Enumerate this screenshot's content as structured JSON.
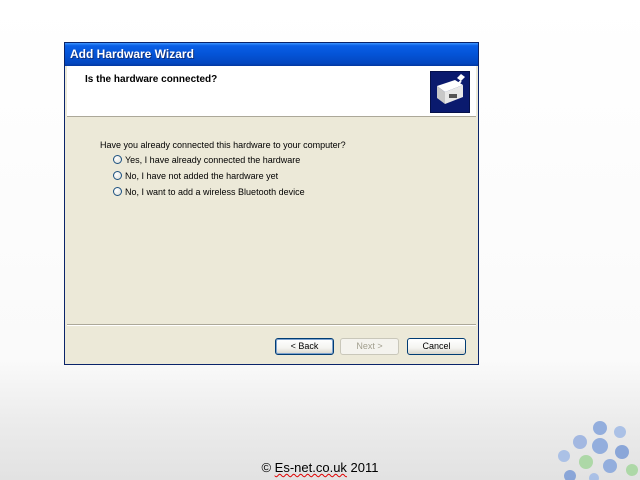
{
  "window": {
    "title": "Add Hardware Wizard",
    "header_title": "Is the hardware connected?"
  },
  "content": {
    "question": "Have you already connected this hardware to your computer?",
    "options": [
      {
        "label": "Yes, I have already connected the hardware",
        "selected": false
      },
      {
        "label": "No, I have not added the hardware yet",
        "selected": false
      },
      {
        "label": "No, I want to add a wireless Bluetooth device",
        "selected": false
      }
    ]
  },
  "buttons": {
    "back": "< Back",
    "next": "Next >",
    "cancel": "Cancel"
  },
  "footer": {
    "prefix": "© ",
    "site": "Es-net.co.uk",
    "year": " 2011"
  },
  "colors": {
    "titlebar": "#0453d6",
    "dialog_bg": "#ece9d8",
    "bubble_blue": "#7f9fd6",
    "bubble_green": "#a6d6a0"
  }
}
